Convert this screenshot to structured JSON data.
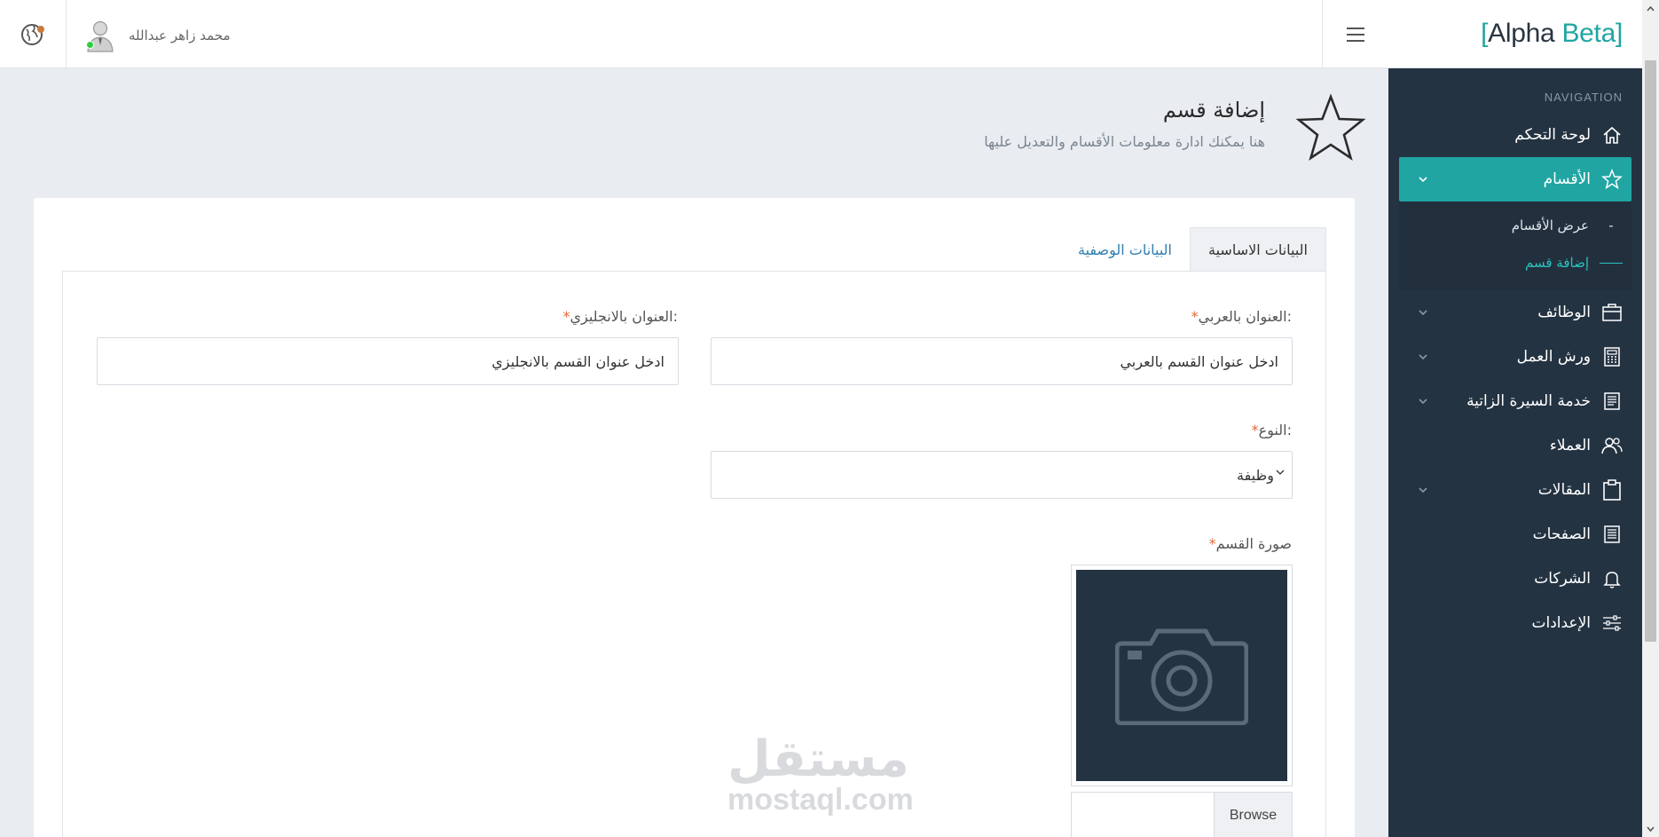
{
  "brand": {
    "bracket_open": "[",
    "alpha": "Alpha",
    "beta": "Beta",
    "bracket_close": "]"
  },
  "topbar": {
    "user_name": "محمد زاهر عبدالله",
    "status_color": "#2ecc40"
  },
  "sidebar": {
    "heading": "NAVIGATION",
    "items": [
      {
        "label": "لوحة التحكم",
        "icon": "home-icon",
        "has_children": false,
        "active": false
      },
      {
        "label": "الأقسام",
        "icon": "star-icon",
        "has_children": true,
        "active": true
      },
      {
        "label": "الوظائف",
        "icon": "briefcase-icon",
        "has_children": true,
        "active": false
      },
      {
        "label": "ورش العمل",
        "icon": "calculator-icon",
        "has_children": true,
        "active": false
      },
      {
        "label": "خدمة السيرة الزاتية",
        "icon": "document-icon",
        "has_children": true,
        "active": false
      },
      {
        "label": "العملاء",
        "icon": "users-icon",
        "has_children": false,
        "active": false
      },
      {
        "label": "المقالات",
        "icon": "clipboard-icon",
        "has_children": true,
        "active": false
      },
      {
        "label": "الصفحات",
        "icon": "pages-icon",
        "has_children": false,
        "active": false
      },
      {
        "label": "الشركات",
        "icon": "bell-icon",
        "has_children": false,
        "active": false
      },
      {
        "label": "الإعدادات",
        "icon": "sliders-icon",
        "has_children": false,
        "active": false
      }
    ],
    "sub_items": [
      {
        "label": "عرض الأقسام",
        "mark": "-",
        "current": false
      },
      {
        "label": "إضافة قسم",
        "mark": "",
        "current": true
      }
    ],
    "accent_color": "#20a5a2",
    "background_color": "#243342"
  },
  "page": {
    "title": "إضافة قسم",
    "subtitle": "هنا يمكنك ادارة معلومات الأقسام والتعديل عليها"
  },
  "tabs": [
    {
      "label": "البيانات الاساسية",
      "active": true
    },
    {
      "label": "البيانات الوصفية",
      "active": false
    }
  ],
  "form": {
    "title_ar_label": "العنوان بالعربي:",
    "title_ar_placeholder": "ادخل عنوان القسم بالعربي",
    "title_en_label": "العنوان بالانجليزي:",
    "title_en_placeholder": "ادخل عنوان القسم بالانجليزي",
    "type_label": "النوع:",
    "type_value": "وظيفة",
    "image_label": "صورة القسم",
    "image_placeholder_icon": "camera-icon",
    "browse_label": "Browse",
    "required_mark": "*"
  },
  "watermark": {
    "arabic": "مستقل",
    "latin": "mostaql.com"
  }
}
